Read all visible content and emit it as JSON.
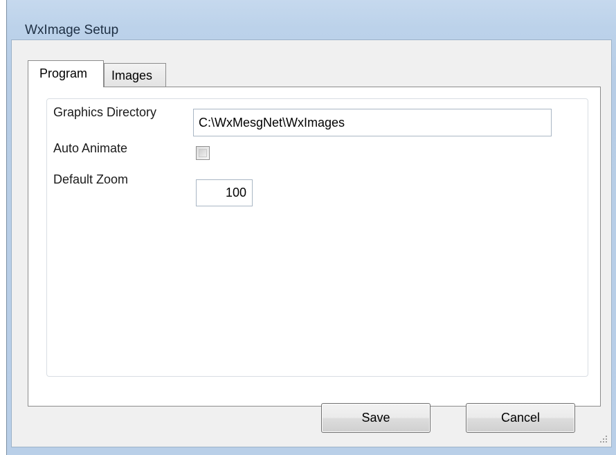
{
  "window": {
    "title": "WxImage Setup"
  },
  "tabs": [
    {
      "label": "Program",
      "active": true
    },
    {
      "label": "Images",
      "active": false
    }
  ],
  "form": {
    "graphics_directory": {
      "label": "Graphics Directory",
      "value": "C:\\WxMesgNet\\WxImages"
    },
    "auto_animate": {
      "label": "Auto Animate",
      "checked": false
    },
    "default_zoom": {
      "label": "Default Zoom",
      "value": "100"
    }
  },
  "buttons": {
    "save_label": "Save",
    "cancel_label": "Cancel"
  },
  "colors": {
    "title_bar": "#bcd2ea",
    "client_background": "#f0f0f0"
  }
}
